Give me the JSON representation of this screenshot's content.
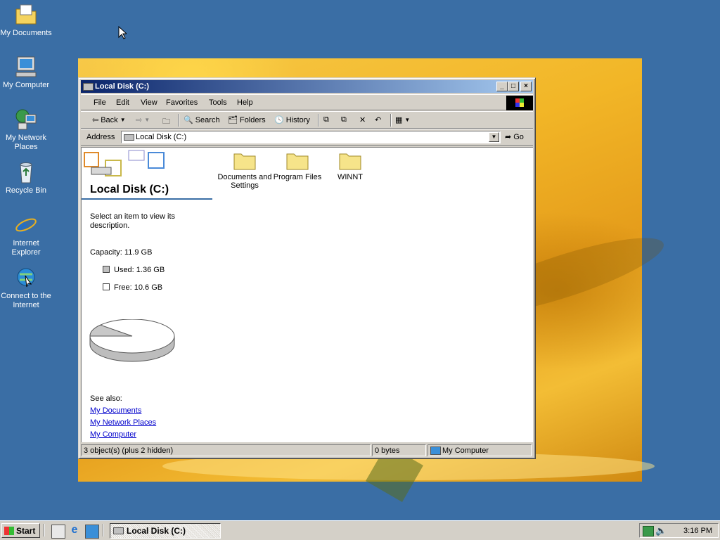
{
  "desktop": {
    "icons": [
      {
        "label": "My Documents"
      },
      {
        "label": "My Computer"
      },
      {
        "label": "My Network Places"
      },
      {
        "label": "Recycle Bin"
      },
      {
        "label": "Internet Explorer"
      },
      {
        "label": "Connect to the Internet"
      }
    ]
  },
  "window": {
    "title": "Local Disk (C:)",
    "menu": [
      "File",
      "Edit",
      "View",
      "Favorites",
      "Tools",
      "Help"
    ],
    "toolbar": {
      "back": "Back",
      "search": "Search",
      "folders": "Folders",
      "history": "History"
    },
    "address": {
      "label": "Address",
      "value": "Local Disk (C:)",
      "go": "Go"
    },
    "left_pane": {
      "title": "Local Disk (C:)",
      "description": "Select an item to view its description.",
      "capacity": "Capacity: 11.9 GB",
      "used": "Used: 1.36 GB",
      "free": "Free: 10.6 GB",
      "used_fraction": 0.114,
      "see_also": "See also:",
      "links": [
        "My Documents",
        "My Network Places",
        "My Computer"
      ]
    },
    "folders": [
      {
        "name": "Documents and Settings"
      },
      {
        "name": "Program Files"
      },
      {
        "name": "WINNT"
      }
    ],
    "status": {
      "objects": "3 object(s) (plus 2 hidden)",
      "size": "0 bytes",
      "zone": "My Computer"
    }
  },
  "taskbar": {
    "start": "Start",
    "task": "Local Disk (C:)",
    "clock": "3:16 PM"
  },
  "colors": {
    "desktop": "#3a6ea5",
    "title_active": "#0a246a",
    "link": "#0000cc"
  }
}
